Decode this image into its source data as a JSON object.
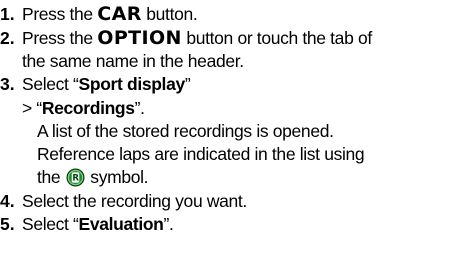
{
  "steps": [
    {
      "number": "1.",
      "pre": "Press the ",
      "keyword": "CAR",
      "post": " button."
    },
    {
      "number": "2.",
      "pre": "Press the ",
      "keyword": "OPTION",
      "post": " button or touch the tab of",
      "line2": "the same name in the header."
    },
    {
      "number": "3.",
      "pre": "Select “",
      "bold": "Sport display",
      "post": "”",
      "sub_pre": "> “",
      "sub_bold": "Recordings",
      "sub_post": "”.",
      "desc1": "A list of the stored recordings is opened.",
      "desc2": "Reference laps are indicated in the list using",
      "desc3_pre": "the ",
      "icon_letter": "R",
      "icon": "reference-lap-icon",
      "desc3_post": " symbol."
    },
    {
      "number": "4.",
      "text": "Select the recording you want."
    },
    {
      "number": "5.",
      "pre": "Select “",
      "bold": "Evaluation",
      "post": "”."
    }
  ],
  "colors": {
    "text": "#000000",
    "icon_fill": "#1f8a2f",
    "icon_ring": "#7fd28a",
    "icon_dark": "#0a3d12"
  }
}
